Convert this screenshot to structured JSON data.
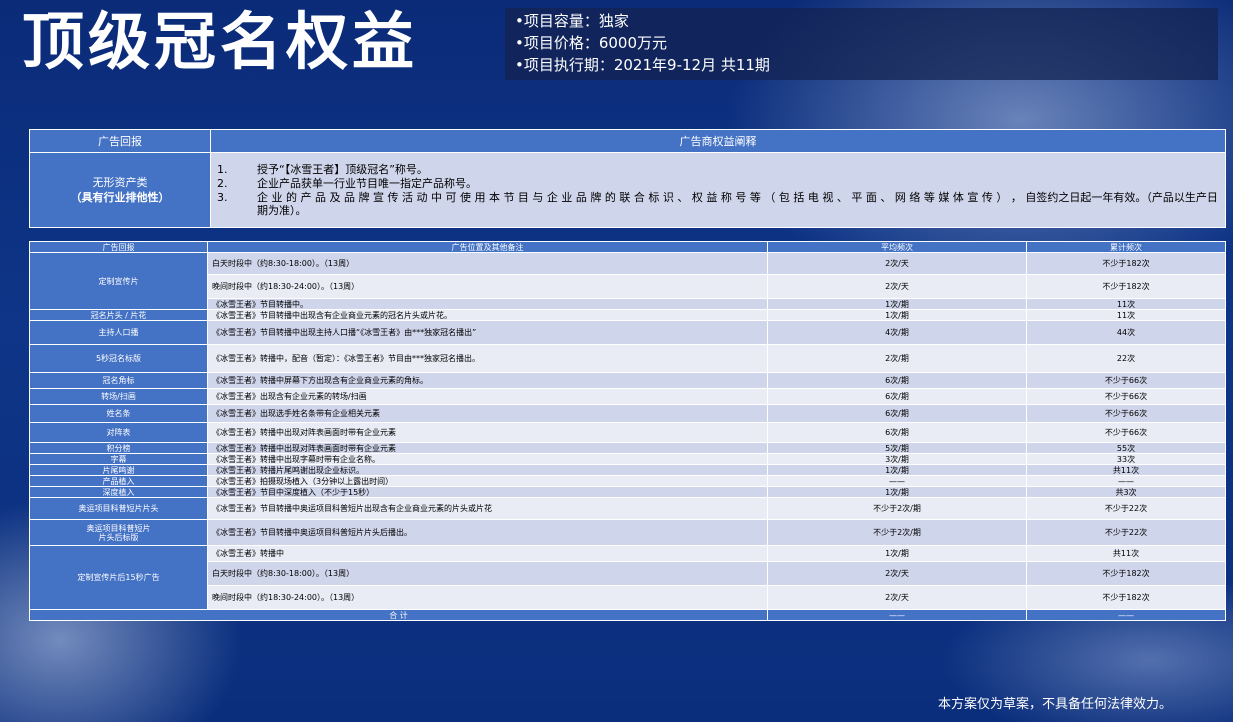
{
  "title": "顶级冠名权益",
  "info": [
    "•项目容量：独家",
    "•项目价格：6000万元",
    "•项目执行期：2021年9-12月   共11期"
  ],
  "rights": {
    "h1": "广告回报",
    "h2": "广告商权益阐释",
    "left1": "无形资产类",
    "left2": "（具有行业排他性）",
    "items": [
      {
        "n": "1.",
        "t": "授予“【冰雪王者】顶级冠名”称号。"
      },
      {
        "n": "2.",
        "t": "企业产品获单一行业节目唯一指定产品称号。"
      },
      {
        "n": "3.",
        "t": "企 业 的 产 品 及 品 牌 宣 传 活 动 中 可 使 用 本 节 目 与 企 业 品 牌 的 联 合 标 识 、 权 益 称 号 等 （ 包 括 电 视 、 平 面 、 网 络 等 媒 体 宣 传 ） ， 自签约之日起一年有效。（产品以生产日期为准）。"
      }
    ]
  },
  "table": {
    "headers": [
      "广告回报",
      "广告位置及其他备注",
      "平均频次",
      "累计频次"
    ],
    "g1": {
      "label": "定制宣传片",
      "rows": [
        [
          "白天时段中（约8:30-18:00）。（13周）",
          "2次/天",
          "不少于182次"
        ],
        [
          "晚间时段中（约18:30-24:00）。（13周）",
          "2次/天",
          "不少于182次"
        ],
        [
          "《冰雪王者》节目转播中。",
          "1次/期",
          "11次"
        ]
      ]
    },
    "rows": [
      [
        "冠名片头 / 片花",
        "《冰雪王者》节目转播中出现含有企业商业元素的冠名片头或片花。",
        "1次/期",
        "11次"
      ],
      [
        "主持人口播",
        "《冰雪王者》节目转播中出现主持人口播“《冰雪王者》由***独家冠名播出”",
        "4次/期",
        "44次"
      ],
      [
        "5秒冠名标版",
        "《冰雪王者》转播中，配音（暂定）：《冰雪王者》节目由***独家冠名播出。",
        "2次/期",
        "22次"
      ],
      [
        "冠名角标",
        "《冰雪王者》转播中屏幕下方出现含有企业商业元素的角标。",
        "6次/期",
        "不少于66次"
      ],
      [
        "转场/扫画",
        "《冰雪王者》出现含有企业元素的转场/扫画",
        "6次/期",
        "不少于66次"
      ],
      [
        "姓名条",
        "《冰雪王者》出现选手姓名条带有企业相关元素",
        "6次/期",
        "不少于66次"
      ],
      [
        "对阵表",
        "《冰雪王者》转播中出现对阵表画面时带有企业元素",
        "6次/期",
        "不少于66次"
      ],
      [
        "积分榜",
        "《冰雪王者》转播中出现对阵表画面时带有企业元素",
        "5次/期",
        "55次"
      ],
      [
        "字幕",
        "《冰雪王者》转播中出现字幕时带有企业名称。",
        "3次/期",
        "33次"
      ],
      [
        "片尾鸣谢",
        "《冰雪王者》转播片尾鸣谢出现企业标识。",
        "1次/期",
        "共11次"
      ],
      [
        "产品植入",
        "《冰雪王者》拍摄现场植入（3分钟以上露出时间）",
        "——",
        "——"
      ],
      [
        "深度植入",
        "《冰雪王者》节目中深度植入（不少于15秒）",
        "1次/期",
        "共3次"
      ],
      [
        "奥运项目科普短片片头",
        "《冰雪王者》节目转播中奥运项目科普短片出现含有企业商业元素的片头或片花",
        "不少于2次/期",
        "不少于22次"
      ],
      [
        "奥运项目科普短片\n片头后标版",
        "《冰雪王者》节目转播中奥运项目科普短片片头后播出。",
        "不少于2次/期",
        "不少于22次"
      ]
    ],
    "g2": {
      "label": "定制宣传片后15秒广告",
      "rows": [
        [
          "《冰雪王者》转播中",
          "1次/期",
          "共11次"
        ],
        [
          "白天时段中（约8:30-18:00）。（13周）",
          "2次/天",
          "不少于182次"
        ],
        [
          "晚间时段中（约18:30-24:00）。（13周）",
          "2次/天",
          "不少于182次"
        ]
      ]
    },
    "total": [
      "合    计",
      "——",
      "——"
    ]
  },
  "footer": "本方案仅为草案，不具备任何法律效力。"
}
